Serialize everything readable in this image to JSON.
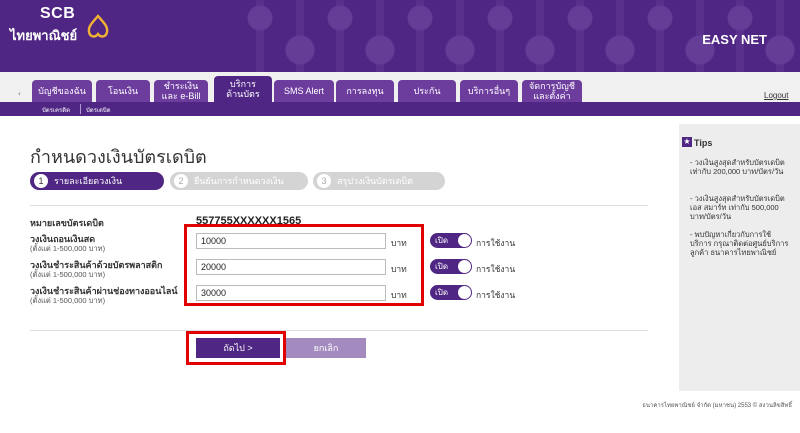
{
  "header": {
    "logo_en": "SCB",
    "logo_th": "ไทยพาณิชย์",
    "product": "EASY NET"
  },
  "nav": {
    "left_arrow": "‹",
    "tabs": [
      {
        "label": "บัญชีของฉัน"
      },
      {
        "label": "โอนเงิน"
      },
      {
        "label": "ชำระเงิน\nและ e-Bill"
      },
      {
        "label": "บริการ\nด้านบัตร"
      },
      {
        "label": "SMS Alert"
      },
      {
        "label": "การลงทุน"
      },
      {
        "label": "ประกัน"
      },
      {
        "label": "บริการอื่นๆ"
      },
      {
        "label": "จัดการบัญชี\nและตั้งค่า"
      }
    ],
    "logout": "Logout"
  },
  "subnav": {
    "items": [
      {
        "label": "บัตรเครดิต"
      },
      {
        "label": "บัตรเดบิต"
      }
    ]
  },
  "main": {
    "title": "กำหนดวงเงินบัตรเดบิต",
    "steps": [
      {
        "num": "1",
        "label": "รายละเอียดวงเงิน"
      },
      {
        "num": "2",
        "label": "ยืนยันการกำหนดวงเงิน"
      },
      {
        "num": "3",
        "label": "สรุปวงเงินบัตรเดบิต"
      }
    ],
    "card_label": "หมายเลขบัตรเดบิต",
    "card_number": "557755XXXXXX1565",
    "limits": [
      {
        "label": "วงเงินถอนเงินสด",
        "range": "(ตั้งแต่ 1-500,000 บาท)",
        "value": "10000",
        "unit": "บาท",
        "toggle": "เปิด",
        "use": "การใช้งาน"
      },
      {
        "label": "วงเงินชำระสินค้าด้วยบัตรพลาสติก",
        "range": "(ตั้งแต่ 1-500,000 บาท)",
        "value": "20000",
        "unit": "บาท",
        "toggle": "เปิด",
        "use": "การใช้งาน"
      },
      {
        "label": "วงเงินชำระสินค้าผ่านช่องทางออนไลน์",
        "range": "(ตั้งแต่ 1-500,000 บาท)",
        "value": "30000",
        "unit": "บาท",
        "toggle": "เปิด",
        "use": "การใช้งาน"
      }
    ],
    "next_button": "ถัดไป >",
    "cancel_button": "ยกเลิก"
  },
  "tips": {
    "title": "Tips",
    "items": [
      "- วงเงินสูงสุดสำหรับบัตรเดบิต เท่ากับ 200,000 บาท/บัตร/วัน",
      "- วงเงินสูงสุดสำหรับบัตรเดบิต เอส สมาร์ท เท่ากับ 500,000 บาท/บัตร/วัน",
      "- พบปัญหาเกี่ยวกับการใช้บริการ กรุณาติดต่อศูนย์บริการลูกค้า ธนาคารไทยพาณิชย์"
    ]
  },
  "footer": {
    "copyright": "ธนาคารไทยพาณิชย์ จำกัด (มหาชน) 2553 © สงวนลิขสิทธิ์"
  },
  "colors": {
    "brand_purple": "#4f2683",
    "tab_purple": "#6d3d9e",
    "highlight_red": "#e00000"
  }
}
